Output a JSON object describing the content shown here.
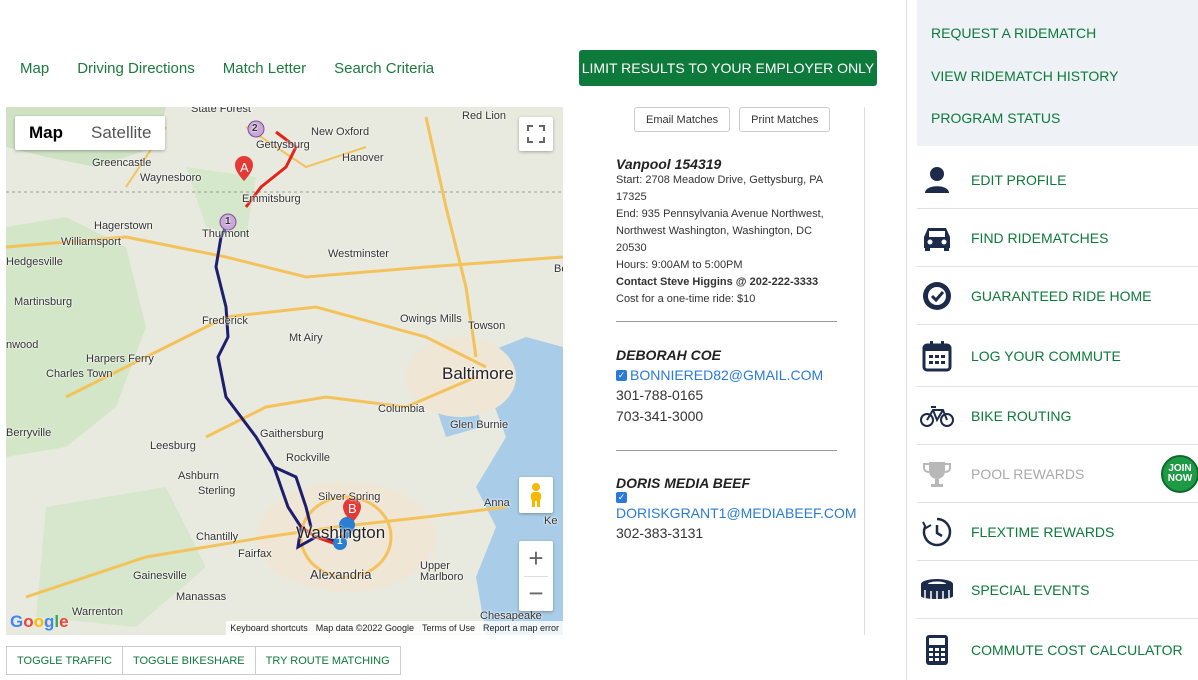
{
  "nav": {
    "tabs": [
      {
        "label": "Map"
      },
      {
        "label": "Driving Directions"
      },
      {
        "label": "Match Letter"
      },
      {
        "label": "Search Criteria"
      }
    ],
    "limit_button": "LIMIT RESULTS TO YOUR EMPLOYER ONLY"
  },
  "map": {
    "type_map": "Map",
    "type_satellite": "Satellite",
    "zoom_in": "+",
    "zoom_out": "−",
    "google": "Google",
    "attribution": [
      "Keyboard shortcuts",
      "Map data ©2022 Google",
      "Terms of Use",
      "Report a map error"
    ],
    "markers": {
      "a": "A",
      "b": "B",
      "w1": "1",
      "w2": "2",
      "w3": "1"
    },
    "labels": {
      "state_forest": "State Forest",
      "new_oxford": "New Oxford",
      "gettysburg": "Gettysburg",
      "red_lion": "Red Lion",
      "greencastle": "Greencastle",
      "waynesboro": "Waynesboro",
      "hanover": "Hanover",
      "emmitsburg": "Emmitsburg",
      "hagerstown": "Hagerstown",
      "thurmont": "Thurmont",
      "williamsport": "Williamsport",
      "westminster": "Westminster",
      "hedgesville": "Hedgesville",
      "martinsburg": "Martinsburg",
      "owings_mills": "Owings Mills",
      "towson": "Towson",
      "frederick": "Frederick",
      "mt_airy": "Mt Airy",
      "harpers_ferry": "Harpers Ferry",
      "nwood": "nwood",
      "charles_town": "Charles Town",
      "baltimore": "Baltimore",
      "columbia": "Columbia",
      "glen_burnie": "Glen Burnie",
      "berryville": "Berryville",
      "gaithersburg": "Gaithersburg",
      "leesburg": "Leesburg",
      "rockville": "Rockville",
      "ashburn": "Ashburn",
      "sterling": "Sterling",
      "silver_spring": "Silver Spring",
      "annapolis": "Anna",
      "chantilly": "Chantilly",
      "washington": "Washington",
      "fairfax": "Fairfax",
      "alexandria": "Alexandria",
      "upper_marlboro": "Upper Marlboro",
      "gainesville": "Gainesville",
      "manassas": "Manassas",
      "warrenton": "Warrenton",
      "chesapeake": "Chesapeake",
      "ke": "Ke",
      "be": "Be"
    }
  },
  "map_buttons": [
    "TOGGLE TRAFFIC",
    "TOGGLE BIKESHARE",
    "TRY ROUTE MATCHING"
  ],
  "matches": {
    "email_btn": "Email Matches",
    "print_btn": "Print Matches",
    "vanpool": {
      "title": "Vanpool 154319",
      "start": "Start: 2708 Meadow Drive, Gettysburg, PA 17325",
      "end": "End: 935 Pennsylvania Avenue Northwest, Northwest Washington, Washington, DC 20530",
      "hours": "Hours: 9:00AM to 5:00PM",
      "contact": "Contact Steve Higgins @ 202-222-3333",
      "cost": "Cost for a one-time ride: $10"
    },
    "people": [
      {
        "name": "DEBORAH COE",
        "email": "BONNIERED82@GMAIL.COM",
        "phones": [
          "301-788-0165",
          "703-341-3000"
        ]
      },
      {
        "name": "DORIS MEDIA BEEF",
        "email": "DORISKGRANT1@MEDIABEEF.COM",
        "phones": [
          "302-383-3131"
        ]
      }
    ]
  },
  "sidebar": {
    "top_links": [
      "REQUEST A RIDEMATCH",
      "VIEW RIDEMATCH HISTORY",
      "PROGRAM STATUS"
    ],
    "items": [
      {
        "label": "EDIT PROFILE",
        "icon": "person-icon"
      },
      {
        "label": "FIND RIDEMATCHES",
        "icon": "car-icon"
      },
      {
        "label": "GUARANTEED RIDE HOME",
        "icon": "badge-check-icon"
      },
      {
        "label": "LOG YOUR COMMUTE",
        "icon": "calendar-icon"
      },
      {
        "label": "BIKE ROUTING",
        "icon": "bike-icon"
      },
      {
        "label": "POOL REWARDS",
        "icon": "trophy-icon",
        "badge": "JOIN NOW"
      },
      {
        "label": "FLEXTIME REWARDS",
        "icon": "clock-icon"
      },
      {
        "label": "SPECIAL EVENTS",
        "icon": "stadium-icon"
      },
      {
        "label": "COMMUTE COST CALCULATOR",
        "icon": "calculator-icon"
      }
    ]
  }
}
